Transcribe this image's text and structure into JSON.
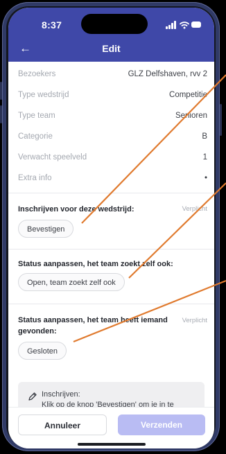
{
  "status_bar": {
    "time": "8:37"
  },
  "header": {
    "title": "Edit",
    "back_icon": "arrow-left-icon"
  },
  "details": [
    {
      "label": "Bezoekers",
      "value": "GLZ Delfshaven, rvv 2"
    },
    {
      "label": "Type wedstrijd",
      "value": "Competitie"
    },
    {
      "label": "Type team",
      "value": "Senioren"
    },
    {
      "label": "Categorie",
      "value": "B"
    },
    {
      "label": "Verwacht speelveld",
      "value": "1"
    },
    {
      "label": "Extra info",
      "value": "•"
    }
  ],
  "sections": [
    {
      "title": "Inschrijven voor deze wedstrijd:",
      "required": "Verplicht",
      "button": "Bevestigen"
    },
    {
      "title": "Status aanpassen, het team zoekt zelf ook:",
      "required": "",
      "button": "Open, team zoekt zelf ook"
    },
    {
      "title_line1": "Status aanpassen, het team heeft iemand",
      "title_line2": "gevonden:",
      "required": "Verplicht",
      "button": "Gesloten"
    }
  ],
  "info": {
    "icon": "pencil-icon",
    "title": "Inschrijven:",
    "text": "Klik op de knop 'Bevestigen' om je in te"
  },
  "footer": {
    "cancel_label": "Annuleer",
    "submit_label": "Verzenden"
  },
  "colors": {
    "header_blue": "#3f48a8",
    "submit_disabled": "#b9bcf3",
    "annotation_orange": "#e07a2e",
    "frame": "#303a66"
  }
}
